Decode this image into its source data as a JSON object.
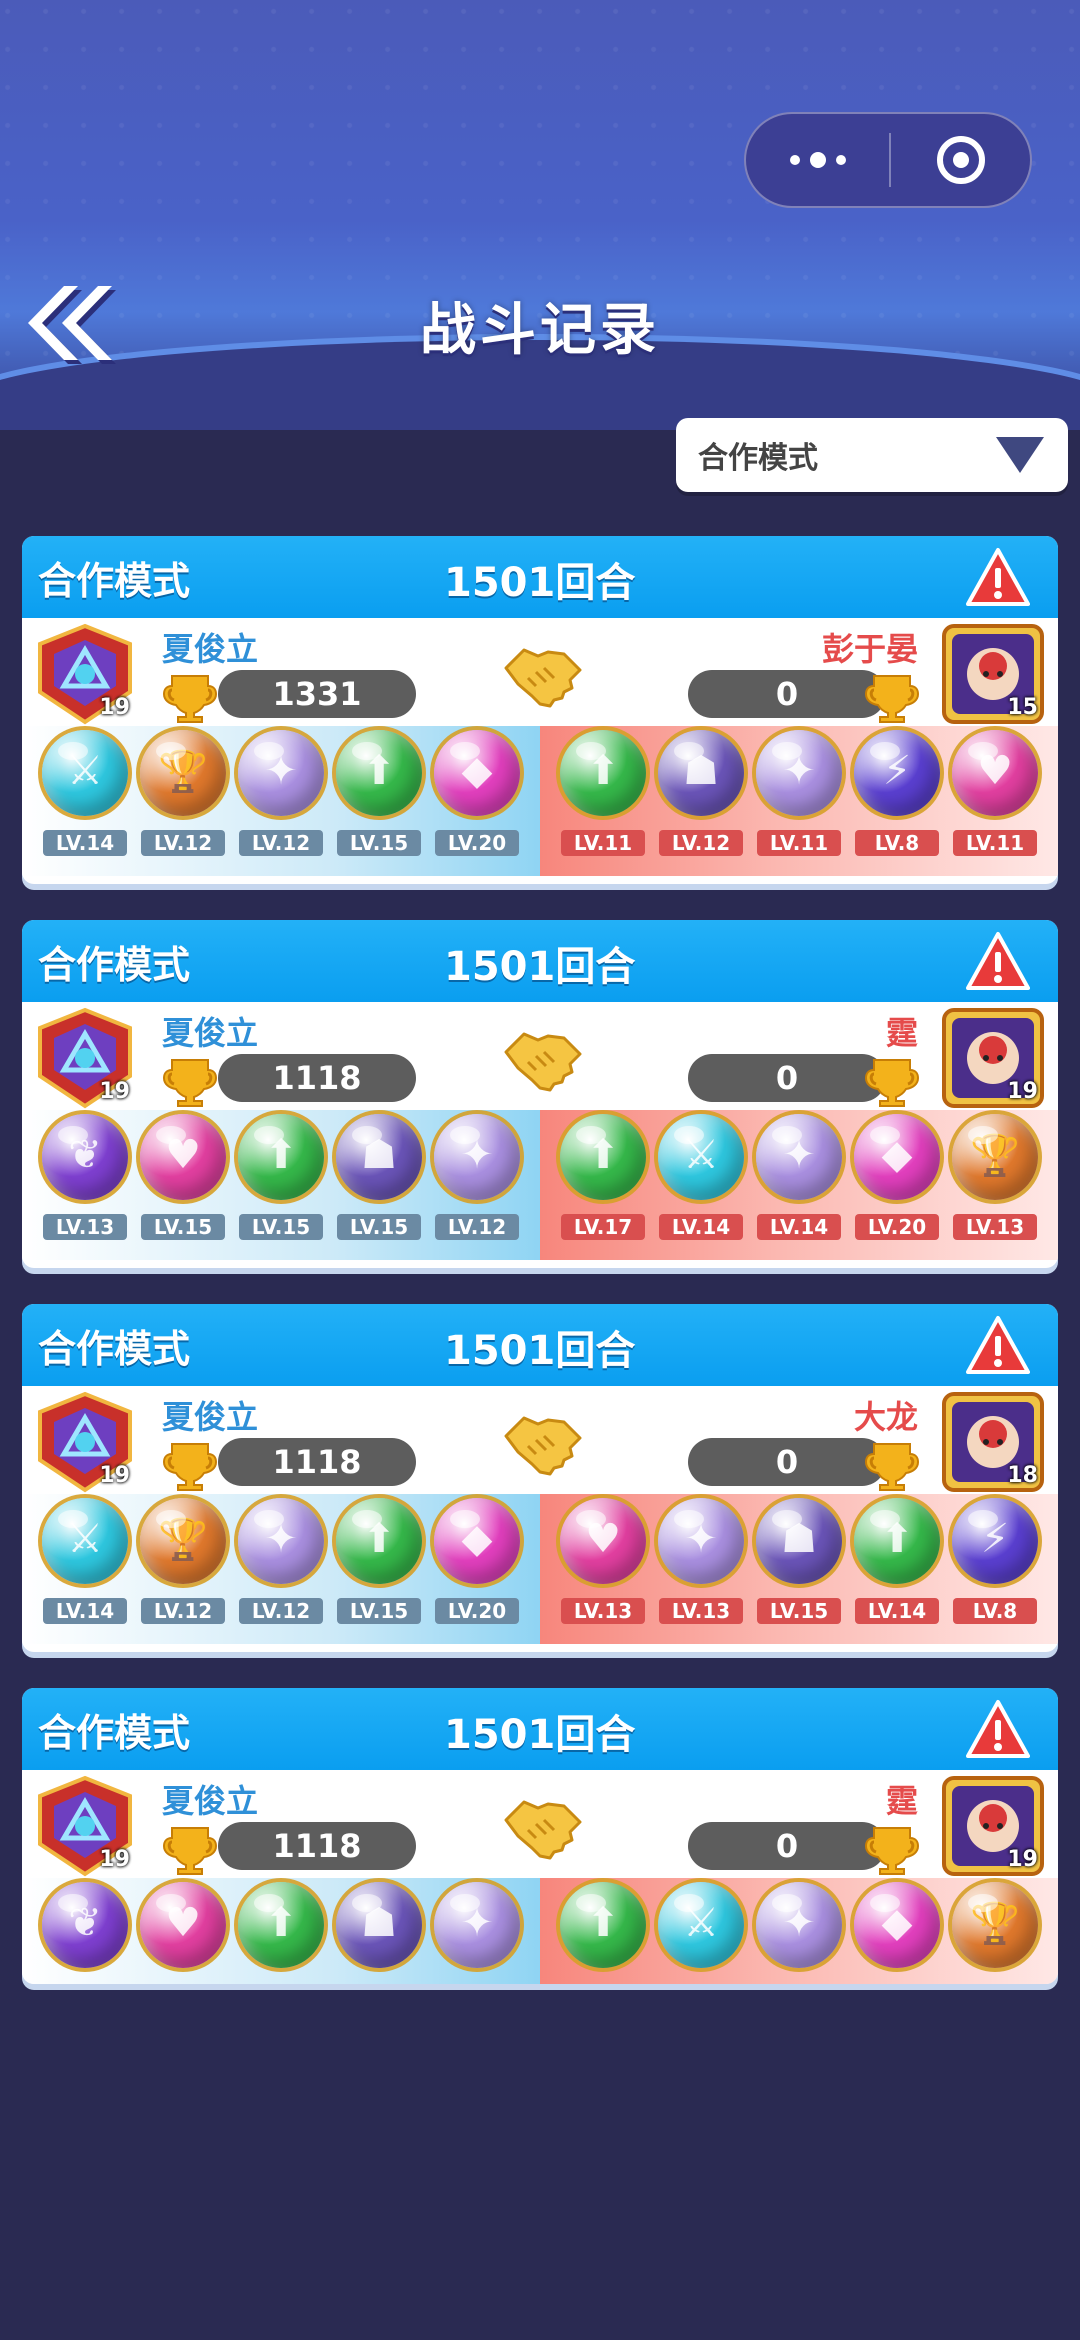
{
  "header": {
    "title": "战斗记录"
  },
  "filter": {
    "selected": "合作模式"
  },
  "colors": {
    "accent": "#0aa0f0",
    "player": "#2f90d8",
    "opponent": "#e54b4b"
  },
  "records": [
    {
      "mode": "合作模式",
      "rounds": "1501回合",
      "left": {
        "name": "夏俊立",
        "score": "1331",
        "level": "19"
      },
      "right": {
        "name": "彭于晏",
        "score": "0",
        "level": "15"
      },
      "left_pets": [
        {
          "lv": "LV.14",
          "color": "#2ec7df",
          "icon": "⚔"
        },
        {
          "lv": "LV.12",
          "color": "#e0782c",
          "icon": "🏆"
        },
        {
          "lv": "LV.12",
          "color": "#a98fe0",
          "icon": "✦"
        },
        {
          "lv": "LV.15",
          "color": "#35b84a",
          "icon": "⬆"
        },
        {
          "lv": "LV.20",
          "color": "#e23fbe",
          "icon": "◆"
        }
      ],
      "right_pets": [
        {
          "lv": "LV.11",
          "color": "#35b84a",
          "icon": "⬆"
        },
        {
          "lv": "LV.12",
          "color": "#6a54b8",
          "icon": "☗"
        },
        {
          "lv": "LV.11",
          "color": "#a98fe0",
          "icon": "✦"
        },
        {
          "lv": "LV.8",
          "color": "#5a3fd0",
          "icon": "⚡"
        },
        {
          "lv": "LV.11",
          "color": "#e23fa0",
          "icon": "♥"
        }
      ]
    },
    {
      "mode": "合作模式",
      "rounds": "1501回合",
      "left": {
        "name": "夏俊立",
        "score": "1118",
        "level": "19"
      },
      "right": {
        "name": "霆",
        "score": "0",
        "level": "19"
      },
      "left_pets": [
        {
          "lv": "LV.13",
          "color": "#7e3fd0",
          "icon": "❦"
        },
        {
          "lv": "LV.15",
          "color": "#e23fa0",
          "icon": "♥"
        },
        {
          "lv": "LV.15",
          "color": "#35b84a",
          "icon": "⬆"
        },
        {
          "lv": "LV.15",
          "color": "#6a54b8",
          "icon": "☗"
        },
        {
          "lv": "LV.12",
          "color": "#a98fe0",
          "icon": "✦"
        }
      ],
      "right_pets": [
        {
          "lv": "LV.17",
          "color": "#35b84a",
          "icon": "⬆"
        },
        {
          "lv": "LV.14",
          "color": "#2ec7df",
          "icon": "⚔"
        },
        {
          "lv": "LV.14",
          "color": "#a98fe0",
          "icon": "✦"
        },
        {
          "lv": "LV.20",
          "color": "#e23fbe",
          "icon": "◆"
        },
        {
          "lv": "LV.13",
          "color": "#e0782c",
          "icon": "🏆"
        }
      ]
    },
    {
      "mode": "合作模式",
      "rounds": "1501回合",
      "left": {
        "name": "夏俊立",
        "score": "1118",
        "level": "19"
      },
      "right": {
        "name": "大龙",
        "score": "0",
        "level": "18"
      },
      "left_pets": [
        {
          "lv": "LV.14",
          "color": "#2ec7df",
          "icon": "⚔"
        },
        {
          "lv": "LV.12",
          "color": "#e0782c",
          "icon": "🏆"
        },
        {
          "lv": "LV.12",
          "color": "#a98fe0",
          "icon": "✦"
        },
        {
          "lv": "LV.15",
          "color": "#35b84a",
          "icon": "⬆"
        },
        {
          "lv": "LV.20",
          "color": "#e23fbe",
          "icon": "◆"
        }
      ],
      "right_pets": [
        {
          "lv": "LV.13",
          "color": "#e23fa0",
          "icon": "♥"
        },
        {
          "lv": "LV.13",
          "color": "#a98fe0",
          "icon": "✦"
        },
        {
          "lv": "LV.15",
          "color": "#6a54b8",
          "icon": "☗"
        },
        {
          "lv": "LV.14",
          "color": "#35b84a",
          "icon": "⬆"
        },
        {
          "lv": "LV.8",
          "color": "#5a3fd0",
          "icon": "⚡"
        }
      ]
    },
    {
      "mode": "合作模式",
      "rounds": "1501回合",
      "left": {
        "name": "夏俊立",
        "score": "1118",
        "level": "19"
      },
      "right": {
        "name": "霆",
        "score": "0",
        "level": "19"
      },
      "left_pets": [
        {
          "lv": "",
          "color": "#7e3fd0",
          "icon": "❦"
        },
        {
          "lv": "",
          "color": "#e23fa0",
          "icon": "♥"
        },
        {
          "lv": "",
          "color": "#35b84a",
          "icon": "⬆"
        },
        {
          "lv": "",
          "color": "#6a54b8",
          "icon": "☗"
        },
        {
          "lv": "",
          "color": "#a98fe0",
          "icon": "✦"
        }
      ],
      "right_pets": [
        {
          "lv": "",
          "color": "#35b84a",
          "icon": "⬆"
        },
        {
          "lv": "",
          "color": "#2ec7df",
          "icon": "⚔"
        },
        {
          "lv": "",
          "color": "#a98fe0",
          "icon": "✦"
        },
        {
          "lv": "",
          "color": "#e23fbe",
          "icon": "◆"
        },
        {
          "lv": "",
          "color": "#e0782c",
          "icon": "🏆"
        }
      ]
    }
  ]
}
